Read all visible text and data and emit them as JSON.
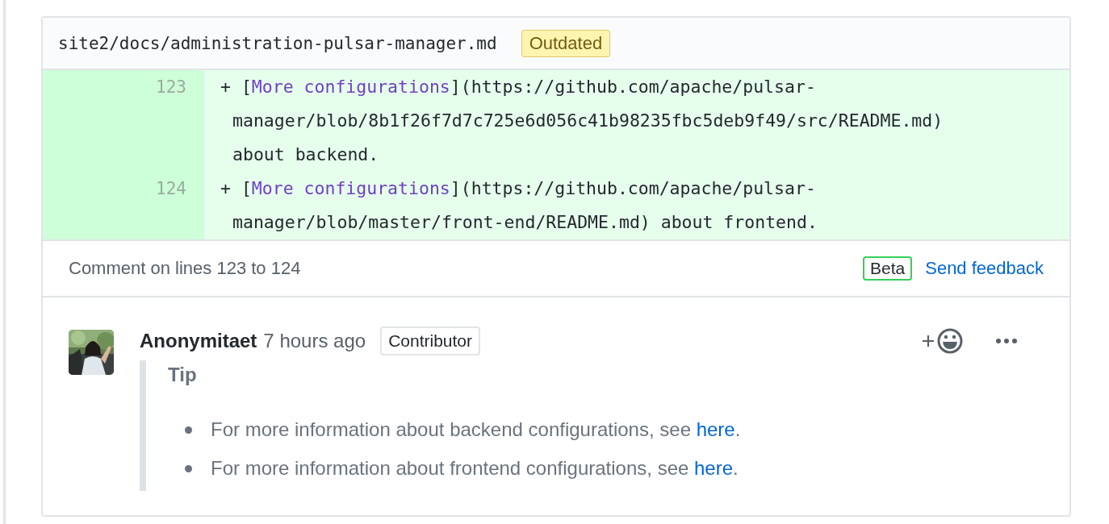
{
  "file": {
    "path": "site2/docs/administration-pulsar-manager.md",
    "badge": "Outdated"
  },
  "diff": {
    "rows": [
      {
        "number": "123",
        "prefix": "+ [",
        "link": "More configurations",
        "rest": "](https://github.com/apache/pulsar-",
        "continuation": [
          "manager/blob/8b1f26f7d7c725e6d056c41b98235fbc5deb9f49/src/README.md)",
          "about backend."
        ]
      },
      {
        "number": "124",
        "prefix": "+ [",
        "link": "More configurations",
        "rest": "](https://github.com/apache/pulsar-",
        "continuation": [
          "manager/blob/master/front-end/README.md) about frontend."
        ]
      }
    ]
  },
  "comment_bar": {
    "text": "Comment on lines 123 to 124",
    "badge": "Beta",
    "link": "Send feedback"
  },
  "comment": {
    "author": "Anonymitaet",
    "time": "7 hours ago",
    "role": "Contributor",
    "quote_title": "Tip",
    "items": [
      {
        "text": "For more information about backend configurations, see ",
        "link": "here",
        "end": "."
      },
      {
        "text": "For more information about frontend configurations, see ",
        "link": "here",
        "end": "."
      }
    ]
  }
}
